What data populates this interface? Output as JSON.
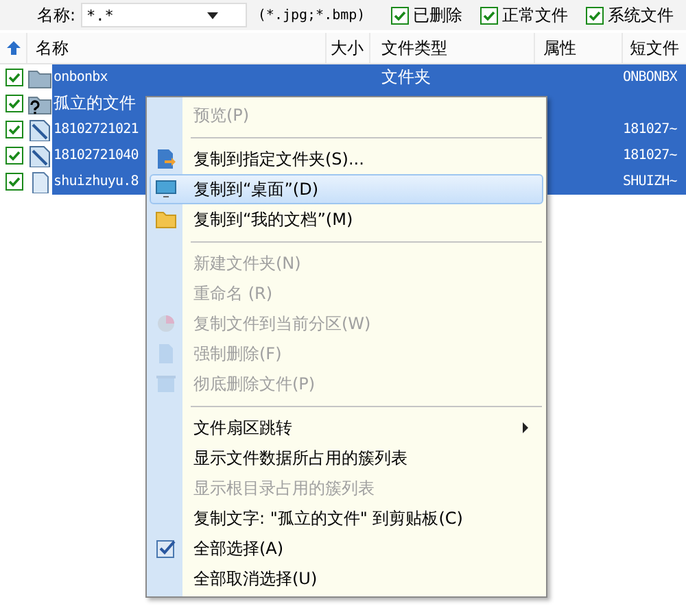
{
  "filter": {
    "label": "名称:",
    "pattern": "*.*",
    "hint": "(*.jpg;*.bmp)",
    "checkboxes": [
      {
        "label": "已删除",
        "checked": true
      },
      {
        "label": "正常文件",
        "checked": true
      },
      {
        "label": "系统文件",
        "checked": true
      }
    ]
  },
  "columns": [
    "名称",
    "大小",
    "文件类型",
    "属性",
    "短文件"
  ],
  "rows": [
    {
      "kind": "folder",
      "name": "onbonbx",
      "type": "文件夹",
      "short": "ONBONBX",
      "checked": true,
      "selected": true
    },
    {
      "kind": "lost-folder",
      "name": "孤立的文件",
      "checked": true,
      "selected": true
    },
    {
      "kind": "image",
      "name": "18102721021",
      "short": "181027~",
      "checked": true,
      "selected": true
    },
    {
      "kind": "image",
      "name": "18102721040",
      "short": "181027~",
      "checked": true,
      "selected": true
    },
    {
      "kind": "file",
      "name": "shuizhuyu.8",
      "short": "SHUIZH~",
      "checked": true,
      "selected": true
    }
  ],
  "context_menu": [
    {
      "kind": "item",
      "label": "预览(P)",
      "disabled": true,
      "selected": false
    },
    {
      "kind": "separator"
    },
    {
      "kind": "item",
      "label": "复制到指定文件夹(S)...",
      "disabled": false,
      "selected": false
    },
    {
      "kind": "item",
      "label": "复制到“桌面”(D)",
      "disabled": false,
      "selected": true
    },
    {
      "kind": "item",
      "label": "复制到“我的文档”(M)",
      "disabled": false,
      "selected": false
    },
    {
      "kind": "separator"
    },
    {
      "kind": "item",
      "label": "新建文件夹(N)",
      "disabled": true,
      "selected": false
    },
    {
      "kind": "item",
      "label": "重命名 (R)",
      "disabled": true,
      "selected": false
    },
    {
      "kind": "item",
      "label": "复制文件到当前分区(W)",
      "disabled": true,
      "selected": false
    },
    {
      "kind": "item",
      "label": "强制删除(F)",
      "disabled": true,
      "selected": false
    },
    {
      "kind": "item",
      "label": "彻底删除文件(P)",
      "disabled": true,
      "selected": false
    },
    {
      "kind": "separator"
    },
    {
      "kind": "item",
      "label": "文件扇区跳转",
      "submenu": true,
      "disabled": false,
      "selected": false
    },
    {
      "kind": "item",
      "label": "显示文件数据所占用的簇列表",
      "disabled": false,
      "selected": false
    },
    {
      "kind": "item",
      "label": "显示根目录占用的簇列表",
      "disabled": true,
      "selected": false
    },
    {
      "kind": "item",
      "label": "复制文字: \"孤立的文件\" 到剪贴板(C)",
      "disabled": false,
      "selected": false
    },
    {
      "kind": "item",
      "label": "全部选择(A)",
      "disabled": false,
      "selected": false
    },
    {
      "kind": "item",
      "label": "全部取消选择(U)",
      "disabled": false,
      "selected": false
    }
  ]
}
